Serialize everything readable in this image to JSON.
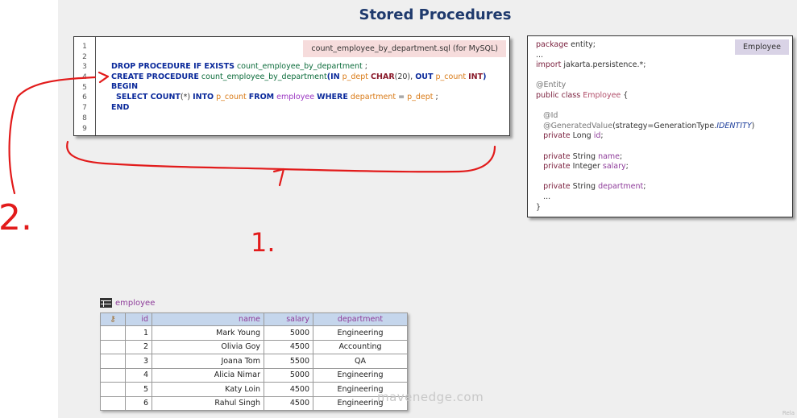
{
  "page": {
    "title": "Stored Procedures",
    "watermark": "mavenedge.com",
    "corner_mark": "Rela"
  },
  "sql_editor": {
    "file_label": "count_employee_by_department.sql (for MySQL)",
    "line_numbers": [
      "1",
      "2",
      "3",
      "4",
      "5",
      "6",
      "7",
      "8",
      "9"
    ],
    "code": {
      "l3_kw1": "DROP PROCEDURE IF EXISTS",
      "l3_fn": "count_employee_by_department",
      "l3_end": " ;",
      "l4_kw1": "CREATE PROCEDURE",
      "l4_fn": "count_employee_by_department",
      "l4_in": "(IN",
      "l4_p1": "p_dept",
      "l4_type1": "CHAR",
      "l4_size": "(20),",
      "l4_out": "OUT",
      "l4_p2": "p_count",
      "l4_type2": "INT",
      "l4_close": ")",
      "l5_kw": "BEGIN",
      "l6_select": "SELECT COUNT",
      "l6_star": "(*)",
      "l6_into": "INTO",
      "l6_var": "p_count",
      "l6_from": "FROM",
      "l6_table": "employee",
      "l6_where": "WHERE",
      "l6_col": "department",
      "l6_eq": " = ",
      "l6_param": "p_dept",
      "l6_end": " ;",
      "l7_kw": "END"
    }
  },
  "java_editor": {
    "tab_label": "Employee",
    "lines": {
      "pkg_kw": "package",
      "pkg_rest": " entity;",
      "dots1": "...",
      "imp_kw": "import",
      "imp_rest": " jakarta.persistence.*;",
      "entity_ann": "@Entity",
      "class_kw": "public class",
      "class_name": "Employee",
      "class_brace": " {",
      "id_ann": "@Id",
      "gen_ann": "@GeneratedValue",
      "gen_open": "(strategy=GenerationType.",
      "gen_val": "IDENTITY",
      "gen_close": ")",
      "f1_kw": "private",
      "f1_type": " Long ",
      "f1_name": "id",
      "f1_end": ";",
      "f2_kw": "private",
      "f2_type": " String ",
      "f2_name": "name",
      "f2_end": ";",
      "f3_kw": "private",
      "f3_type": " Integer ",
      "f3_name": "salary",
      "f3_end": ";",
      "f4_kw": "private",
      "f4_type": " String ",
      "f4_name": "department",
      "f4_end": ";",
      "dots2": "...",
      "close": "}"
    }
  },
  "employee_table": {
    "caption": "employee",
    "columns": [
      "id",
      "name",
      "salary",
      "department"
    ],
    "rows": [
      {
        "id": "1",
        "name": "Mark Young",
        "salary": "5000",
        "department": "Engineering"
      },
      {
        "id": "2",
        "name": "Olivia Goy",
        "salary": "4500",
        "department": "Accounting"
      },
      {
        "id": "3",
        "name": "Joana Tom",
        "salary": "5500",
        "department": "QA"
      },
      {
        "id": "4",
        "name": "Alicia Nimar",
        "salary": "5000",
        "department": "Engineering"
      },
      {
        "id": "5",
        "name": "Katy Loin",
        "salary": "4500",
        "department": "Engineering"
      },
      {
        "id": "6",
        "name": "Rahul Singh",
        "salary": "4500",
        "department": "Engineering"
      }
    ]
  },
  "annotations": {
    "step_2_label": "2.",
    "step_1_label": "1.",
    "ink_color": "#e21b1b"
  }
}
